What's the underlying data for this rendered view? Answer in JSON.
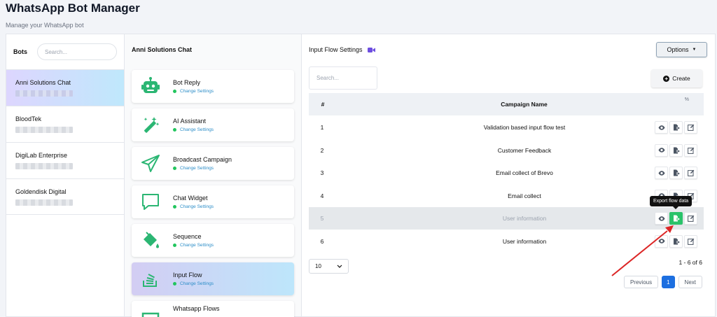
{
  "header": {
    "title": "WhatsApp Bot Manager",
    "subtitle": "Manage your WhatsApp bot"
  },
  "bots_panel": {
    "title": "Bots",
    "search_placeholder": "Search...",
    "items": [
      {
        "name": "Anni Solutions Chat",
        "active": true
      },
      {
        "name": "BloodTek",
        "active": false
      },
      {
        "name": "DigiLab Enterprise",
        "active": false
      },
      {
        "name": "Goldendisk Digital",
        "active": false
      }
    ]
  },
  "features_panel": {
    "title": "Anni Solutions Chat",
    "change_label": "Change Settings",
    "status_color": "#22c55e",
    "items": [
      {
        "name": "Bot Reply",
        "icon": "robot-icon",
        "active": false
      },
      {
        "name": "AI Assistant",
        "icon": "magic-wand-icon",
        "active": false
      },
      {
        "name": "Broadcast Campaign",
        "icon": "paper-plane-icon",
        "active": false
      },
      {
        "name": "Chat Widget",
        "icon": "chat-bubble-icon",
        "active": false
      },
      {
        "name": "Sequence",
        "icon": "paint-bucket-icon",
        "active": false
      },
      {
        "name": "Input Flow",
        "icon": "stack-overflow-icon",
        "active": true
      },
      {
        "name": "Whatsapp Flows",
        "icon": "flows-icon",
        "active": false
      }
    ]
  },
  "main": {
    "title": "Input Flow Settings",
    "title_icon": "video-icon",
    "options_label": "Options",
    "search_placeholder": "Search...",
    "create_label": "Create",
    "columns": {
      "num": "#",
      "name": "Campaign Name",
      "actions": "%"
    },
    "rows": [
      {
        "num": "1",
        "name": "Validation based input flow test"
      },
      {
        "num": "2",
        "name": "Customer Feedback"
      },
      {
        "num": "3",
        "name": "Email collect of Brevo"
      },
      {
        "num": "4",
        "name": "Email collect"
      },
      {
        "num": "5",
        "name": "User information"
      },
      {
        "num": "6",
        "name": "User information"
      }
    ],
    "tooltip": "Export flow data",
    "page_size": "10",
    "page_info": "1 - 6 of 6",
    "pagination": {
      "prev": "Previous",
      "current": "1",
      "next": "Next"
    },
    "accent_color": "#1d6fe0",
    "highlight_color": "#2ac36a"
  }
}
